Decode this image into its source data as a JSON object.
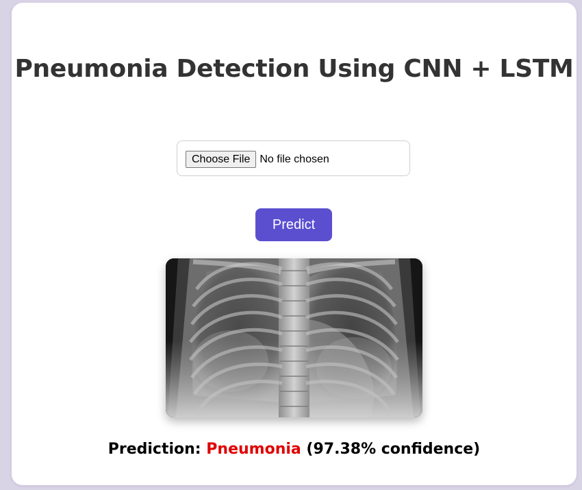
{
  "page": {
    "title": "Pneumonia Detection Using CNN + LSTM"
  },
  "upload": {
    "button_label": "Choose File",
    "status_text": "No file chosen"
  },
  "predict_button": {
    "label": "Predict"
  },
  "result": {
    "prefix": "Prediction:",
    "label": "Pneumonia",
    "confidence_text": "(97.38% confidence)",
    "label_color": "#e00000"
  },
  "colors": {
    "accent": "#5b4fd0",
    "background": "#d9d3e6"
  }
}
